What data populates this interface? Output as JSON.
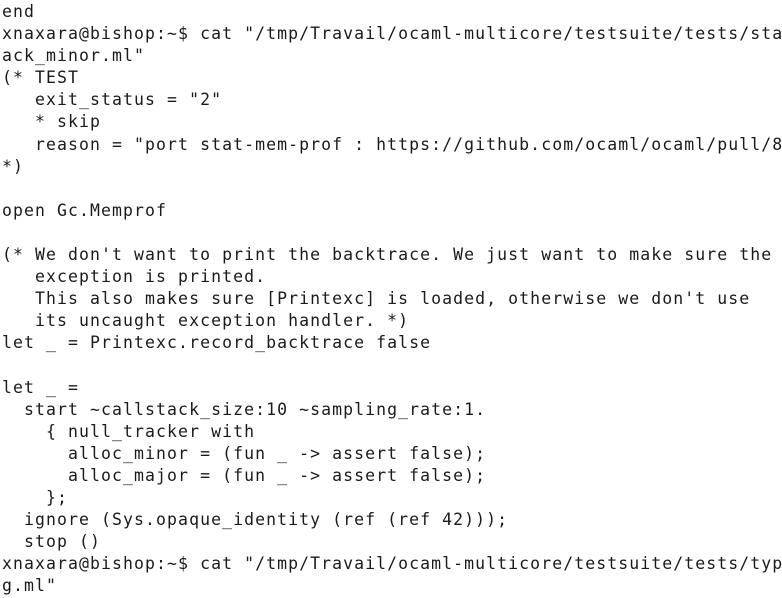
{
  "terminal": {
    "lines": [
      "end",
      "xnaxara@bishop:~$ cat \"/tmp/Travail/ocaml-multicore/testsuite/tests/sta",
      "ack_minor.ml\"",
      "(* TEST",
      "   exit_status = \"2\"",
      "   * skip",
      "   reason = \"port stat-mem-prof : https://github.com/ocaml/ocaml/pull/8",
      "*)",
      "",
      "open Gc.Memprof",
      "",
      "(* We don't want to print the backtrace. We just want to make sure the",
      "   exception is printed.",
      "   This also makes sure [Printexc] is loaded, otherwise we don't use",
      "   its uncaught exception handler. *)",
      "let _ = Printexc.record_backtrace false",
      "",
      "let _ =",
      "  start ~callstack_size:10 ~sampling_rate:1.",
      "    { null_tracker with",
      "      alloc_minor = (fun _ -> assert false);",
      "      alloc_major = (fun _ -> assert false);",
      "    };",
      "  ignore (Sys.opaque_identity (ref (ref 42)));",
      "  stop ()",
      "xnaxara@bishop:~$ cat \"/tmp/Travail/ocaml-multicore/testsuite/tests/typ",
      "g.ml\""
    ]
  }
}
